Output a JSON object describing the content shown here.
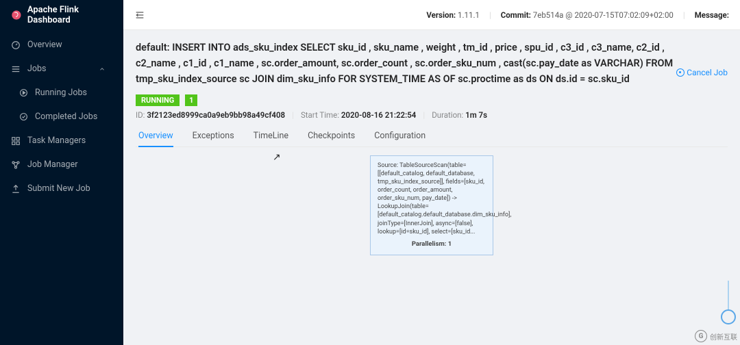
{
  "brand": {
    "title": "Apache Flink Dashboard"
  },
  "sidebar": {
    "items": [
      {
        "label": "Overview",
        "icon": "dashboard-icon"
      },
      {
        "label": "Jobs",
        "icon": "bars-icon",
        "expanded": true
      },
      {
        "label": "Task Managers",
        "icon": "grid-icon"
      },
      {
        "label": "Job Manager",
        "icon": "cluster-icon"
      },
      {
        "label": "Submit New Job",
        "icon": "upload-icon"
      }
    ],
    "jobs_sub": [
      {
        "label": "Running Jobs",
        "icon": "play-icon"
      },
      {
        "label": "Completed Jobs",
        "icon": "check-icon"
      }
    ]
  },
  "topbar": {
    "version_label": "Version:",
    "version": "1.11.1",
    "commit_label": "Commit:",
    "commit": "7eb514a @ 2020-07-15T07:02:09+02:00",
    "message_label": "Message:"
  },
  "job": {
    "title": "default: INSERT INTO ads_sku_index SELECT sku_id , sku_name , weight , tm_id , price , spu_id , c3_id , c3_name, c2_id , c2_name , c1_id , c1_name , sc.order_amount, sc.order_count , sc.order_sku_num , cast(sc.pay_date as VARCHAR) FROM tmp_sku_index_source sc JOIN dim_sku_info FOR SYSTEM_TIME AS OF sc.proctime as ds ON ds.id = sc.sku_id",
    "status": "RUNNING",
    "count": "1",
    "id_label": "ID:",
    "id": "3f2123ed8999ca0a9eb9bb98a49cf408",
    "start_label": "Start Time:",
    "start": "2020-08-16 21:22:54",
    "dur_label": "Duration:",
    "dur": "1m 7s",
    "cancel": "Cancel Job"
  },
  "tabs": {
    "items": [
      "Overview",
      "Exceptions",
      "TimeLine",
      "Checkpoints",
      "Configuration"
    ],
    "active": 0
  },
  "node": {
    "text": "Source: TableSourceScan(table=[[default_catalog, default_database, tmp_sku_index_source]], fields=[sku_id, order_count, order_amount, order_sku_num, pay_date]) -> LookupJoin(table=[default_catalog.default_database.dim_sku_info], joinType=[InnerJoin], async=[false], lookup=[id=sku_id], select=[sku_id...",
    "parallelism": "Parallelism: 1"
  },
  "corner": {
    "text": "创新互联"
  }
}
